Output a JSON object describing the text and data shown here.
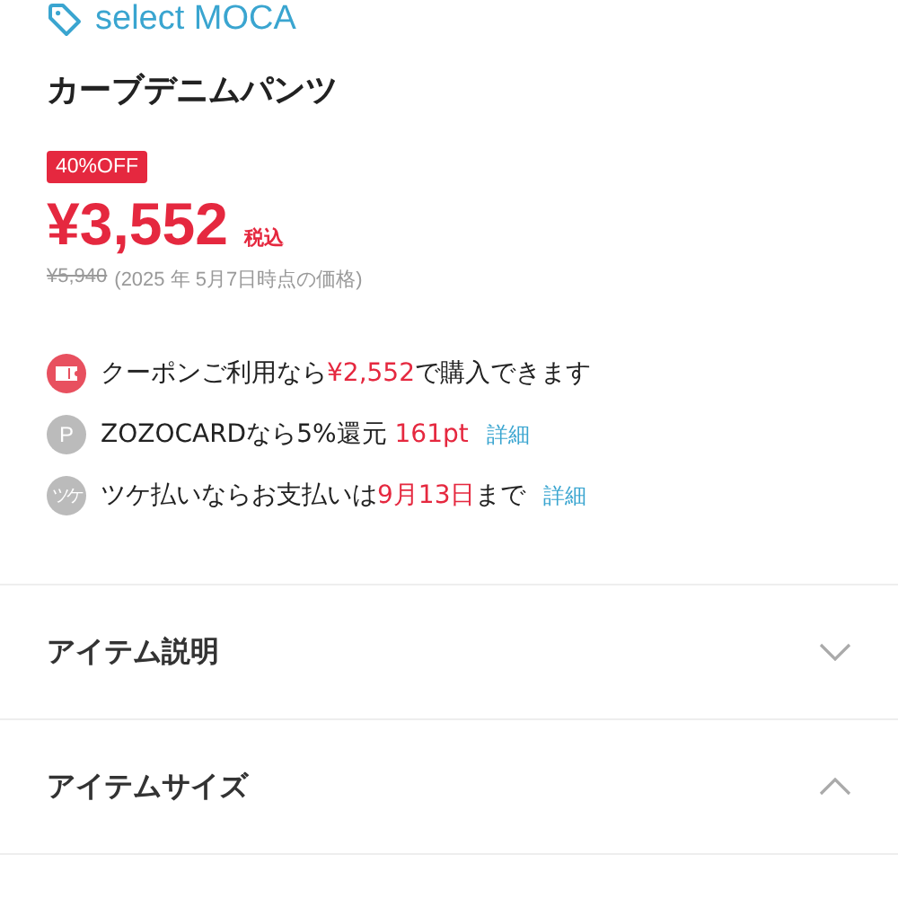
{
  "brand": "select MOCA",
  "title": "カーブデニムパンツ",
  "discount_badge": "40%OFF",
  "price": {
    "amount": "¥3,552",
    "tax_note": "税込",
    "original": "¥5,940",
    "date_note": "(2025 年 5月7日時点の価格)"
  },
  "benefits": [
    {
      "kind": "coupon",
      "segments": [
        {
          "text": "クーポンご利用なら",
          "highlight": false
        },
        {
          "text": "¥2,552",
          "highlight": true
        },
        {
          "text": "で購入できます",
          "highlight": false
        }
      ]
    },
    {
      "kind": "card",
      "icon_text": "P",
      "segments": [
        {
          "text": "ZOZOCARDなら5%還元 ",
          "highlight": false
        },
        {
          "text": "161pt",
          "highlight": true
        }
      ],
      "link": "詳細"
    },
    {
      "kind": "deferred",
      "icon_text": "ツケ",
      "segments": [
        {
          "text": "ツケ払いならお支払いは",
          "highlight": false
        },
        {
          "text": "9月13日",
          "highlight": true
        },
        {
          "text": "まで",
          "highlight": false
        }
      ],
      "link": "詳細"
    }
  ],
  "sections": [
    {
      "label": "アイテム説明",
      "expanded": false
    },
    {
      "label": "アイテムサイズ",
      "expanded": true
    }
  ]
}
